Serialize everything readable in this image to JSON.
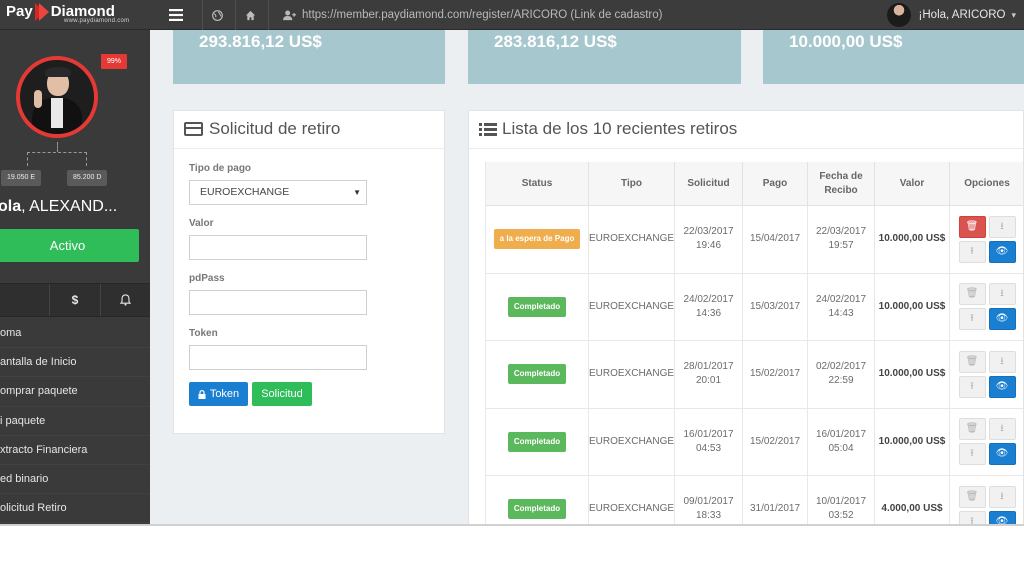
{
  "brand": {
    "pay": "Pay",
    "diamond": "Diamond",
    "sub": "www.paydiamond.com"
  },
  "topbar": {
    "url": "https://member.paydiamond.com/register/ARICORO (Link de cadastro)",
    "greeting": "¡Hola, ARICORO",
    "menu_icon": "menu-icon",
    "globe_icon": "globe-icon",
    "home_icon": "home-icon",
    "user_plus_icon": "user-plus-icon",
    "caret": "▾"
  },
  "sidebar": {
    "badge": "99%",
    "left_leg": "19.050 E",
    "right_leg": "85.200 D",
    "hola_bold": "ola",
    "hola_name": ", ALEXAND...",
    "status": "Activo",
    "icon_dollar": "$",
    "menu": [
      "oma",
      "antalla de Inicio",
      "omprar paquete",
      "i paquete",
      "xtracto Financiera",
      "ed binario",
      "olicitud Retiro"
    ]
  },
  "stats": [
    "293.816,12 US$",
    "283.816,12 US$",
    "10.000,00 US$"
  ],
  "form": {
    "title": "Solicitud de retiro",
    "tipo_label": "Tipo de pago",
    "tipo_value": "EUROEXCHANGE",
    "valor_label": "Valor",
    "pdpass_label": "pdPass",
    "token_label": "Token",
    "btn_token": "Token",
    "btn_solicitud": "Solicitud"
  },
  "list": {
    "title": "Lista de los 10 recientes retiros",
    "headers": [
      "Status",
      "Tipo",
      "Solicitud",
      "Pago",
      "Fecha de Recibo",
      "Valor",
      "Opciones"
    ],
    "rows": [
      {
        "status": "a la espera de Pago",
        "tipo": "EUROEXCHANGE",
        "solicitud": "22/03/2017 19:46",
        "pago": "15/04/2017",
        "recibo": "22/03/2017 19:57",
        "valor": "10.000,00 US$"
      },
      {
        "status": "Completado",
        "tipo": "EUROEXCHANGE",
        "solicitud": "24/02/2017 14:36",
        "pago": "15/03/2017",
        "recibo": "24/02/2017 14:43",
        "valor": "10.000,00 US$"
      },
      {
        "status": "Completado",
        "tipo": "EUROEXCHANGE",
        "solicitud": "28/01/2017 20:01",
        "pago": "15/02/2017",
        "recibo": "02/02/2017 22:59",
        "valor": "10.000,00 US$"
      },
      {
        "status": "Completado",
        "tipo": "EUROEXCHANGE",
        "solicitud": "16/01/2017 04:53",
        "pago": "15/02/2017",
        "recibo": "16/01/2017 05:04",
        "valor": "10.000,00 US$"
      },
      {
        "status": "Completado",
        "tipo": "EUROEXCHANGE",
        "solicitud": "09/01/2017 18:33",
        "pago": "31/01/2017",
        "recibo": "10/01/2017 03:52",
        "valor": "4.000,00 US$"
      }
    ]
  },
  "colors": {
    "topbar": "#3c3c3c",
    "sidebar": "#3a3a3a",
    "accent_red": "#e53935",
    "green": "#2ebd59",
    "blue": "#1a7fd1",
    "orange": "#f0ad4e",
    "stat_bg": "#a7c7cf"
  }
}
